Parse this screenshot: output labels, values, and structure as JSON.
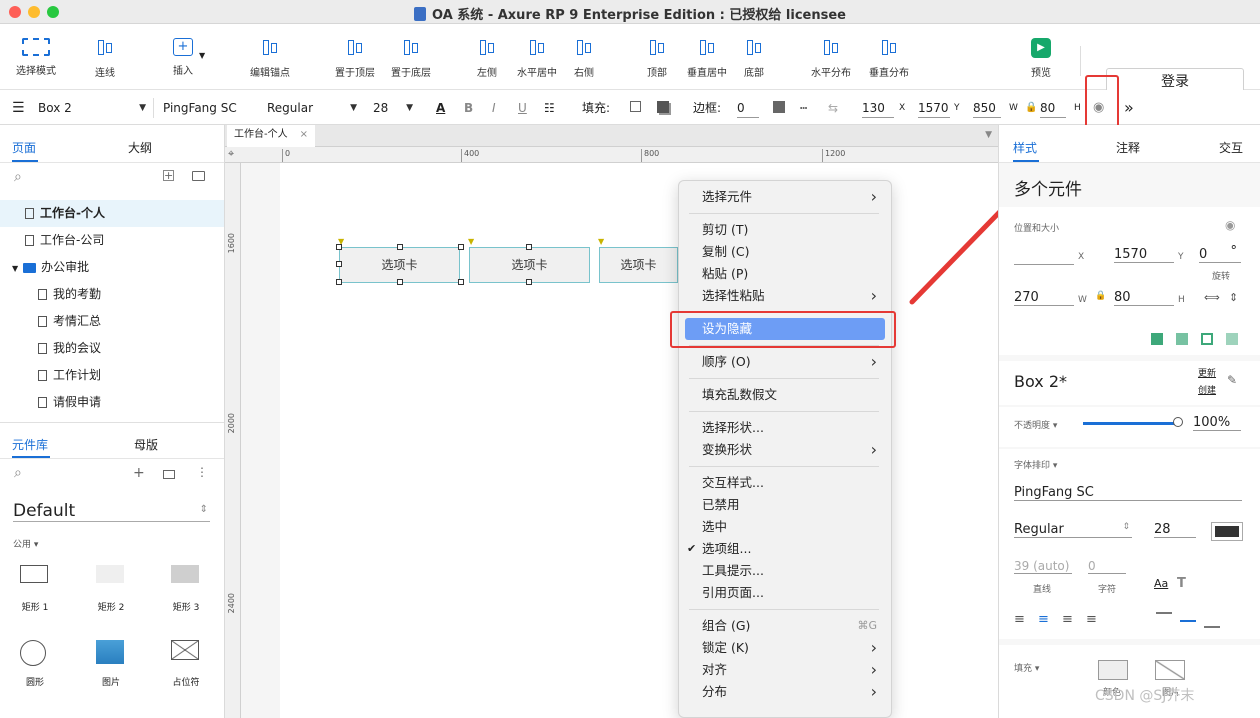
{
  "window": {
    "title": "OA 系统 - Axure RP 9 Enterprise Edition : 已授权给 licensee"
  },
  "toolbar": {
    "tools": [
      {
        "label": "选择模式",
        "icon": "select-mode-icon"
      },
      {
        "label": "连线",
        "icon": "connector-icon"
      },
      {
        "label": "插入",
        "icon": "insert-icon"
      },
      {
        "label": "编辑锚点",
        "icon": "edit-anchor-icon"
      },
      {
        "label": "置于顶层",
        "icon": "bring-to-front-icon"
      },
      {
        "label": "置于底层",
        "icon": "send-to-back-icon"
      },
      {
        "label": "左侧",
        "icon": "align-left-icon"
      },
      {
        "label": "水平居中",
        "icon": "align-center-h-icon"
      },
      {
        "label": "右侧",
        "icon": "align-right-icon"
      },
      {
        "label": "顶部",
        "icon": "align-top-icon"
      },
      {
        "label": "垂直居中",
        "icon": "align-center-v-icon"
      },
      {
        "label": "底部",
        "icon": "align-bottom-icon"
      },
      {
        "label": "水平分布",
        "icon": "distribute-h-icon"
      },
      {
        "label": "垂直分布",
        "icon": "distribute-v-icon"
      },
      {
        "label": "预览",
        "icon": "preview-icon"
      }
    ],
    "login_label": "登录"
  },
  "propbar": {
    "style_name": "Box 2",
    "font": "PingFang SC",
    "weight": "Regular",
    "size": "28",
    "fill_label": "填充:",
    "border_label": "边框:",
    "border_value": "0",
    "x": "130",
    "x_label": "X",
    "y": "1570",
    "y_label": "Y",
    "w": "850",
    "w_label": "W",
    "h": "80",
    "h_label": "H"
  },
  "left": {
    "pages_tab": "页面",
    "outline_tab": "大纲",
    "pages": [
      {
        "label": "工作台-个人",
        "selected": true
      },
      {
        "label": "工作台-公司"
      },
      {
        "label": "办公审批",
        "folder": true
      },
      {
        "label": "我的考勤"
      },
      {
        "label": "考情汇总"
      },
      {
        "label": "我的会议"
      },
      {
        "label": "工作计划"
      },
      {
        "label": "请假申请"
      }
    ],
    "lib_tab": "元件库",
    "master_tab": "母版",
    "library": "Default",
    "category": "公用",
    "widgets": [
      "矩形 1",
      "矩形 2",
      "矩形 3",
      "圆形",
      "图片",
      "占位符"
    ]
  },
  "canvas": {
    "tab_label": "工作台-个人",
    "ruler_top": [
      "0",
      "400",
      "800",
      "1200"
    ],
    "ruler_left": [
      "1600",
      "2000",
      "2400"
    ],
    "widgets": [
      "选项卡",
      "选项卡",
      "选项卡"
    ]
  },
  "menu": {
    "items": [
      {
        "label": "选择元件",
        "sub": true
      },
      {
        "label": "剪切 (T)"
      },
      {
        "label": "复制 (C)"
      },
      {
        "label": "粘贴 (P)"
      },
      {
        "label": "选择性粘贴",
        "sub": true
      },
      {
        "label": "设为隐藏",
        "highlight": true
      },
      {
        "label": "顺序 (O)",
        "sub": true
      },
      {
        "label": "填充乱数假文"
      },
      {
        "label": "选择形状..."
      },
      {
        "label": "变换形状",
        "sub": true
      },
      {
        "label": "交互样式..."
      },
      {
        "label": "已禁用"
      },
      {
        "label": "选中"
      },
      {
        "label": "选项组...",
        "checked": true
      },
      {
        "label": "工具提示..."
      },
      {
        "label": "引用页面..."
      },
      {
        "label": "组合 (G)",
        "shortcut": "⌘G"
      },
      {
        "label": "锁定 (K)",
        "sub": true
      },
      {
        "label": "对齐",
        "sub": true
      },
      {
        "label": "分布",
        "sub": true
      }
    ]
  },
  "right": {
    "tabs": [
      "样式",
      "注释",
      "交互"
    ],
    "heading": "多个元件",
    "pos_label": "位置和大小",
    "x_label": "X",
    "y": "1570",
    "y_label": "Y",
    "rot": "0",
    "rot_unit": "°",
    "rot_label": "旋转",
    "w": "270",
    "w_label": "W",
    "h": "80",
    "h_label": "H",
    "style_name": "Box 2*",
    "update_label": "更新",
    "create_label": "创建",
    "opacity_label": "不透明度",
    "opacity": "100%",
    "opacity_frac": 1.0,
    "typography_label": "字体排印",
    "font": "PingFang SC",
    "weight": "Regular",
    "size": "28",
    "line_value": "39 (auto)",
    "line_label": "直线",
    "char_value": "0",
    "char_label": "字符",
    "fill_label": "填充",
    "color_label": "颜色",
    "image_label": "图片"
  },
  "watermark": "CSDN @SJ芥末",
  "colors": {
    "accent": "#1a6fd6",
    "highlight": "#6d9df5",
    "annotation": "#e53935",
    "preview": "#16a86b"
  }
}
